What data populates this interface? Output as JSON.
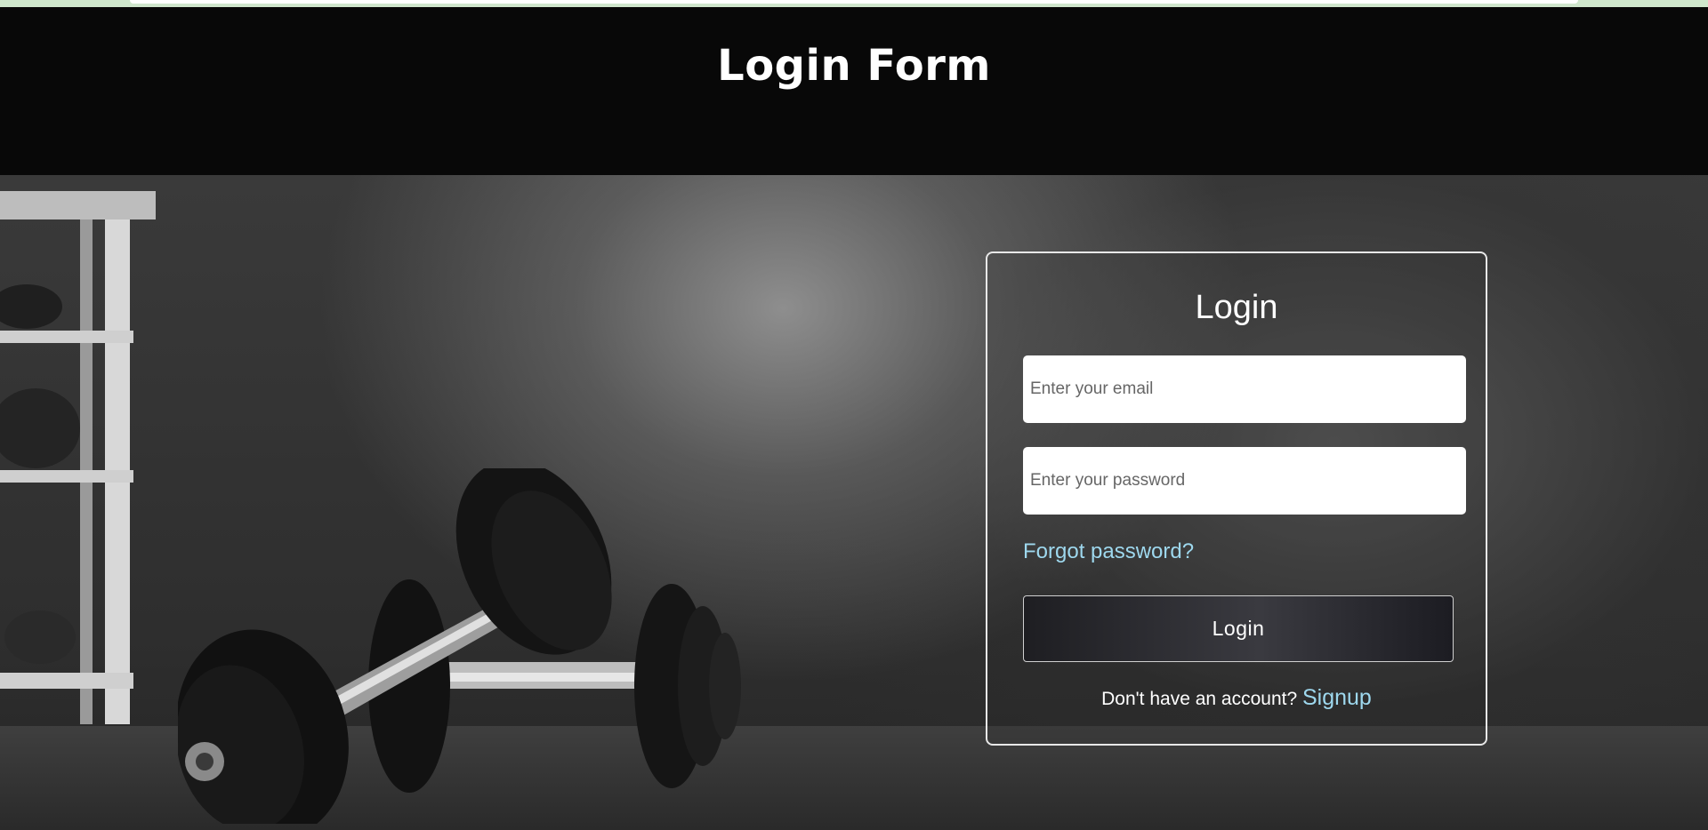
{
  "header": {
    "title": "Login Form"
  },
  "login": {
    "title": "Login",
    "email_placeholder": "Enter your email",
    "password_placeholder": "Enter your password",
    "forgot_label": "Forgot password?",
    "submit_label": "Login",
    "signup_prompt": "Don't have an account?",
    "signup_label": "Signup"
  },
  "colors": {
    "header_bg": "#080808",
    "link": "#9ed8ee",
    "card_border": "#e8e8e8"
  }
}
